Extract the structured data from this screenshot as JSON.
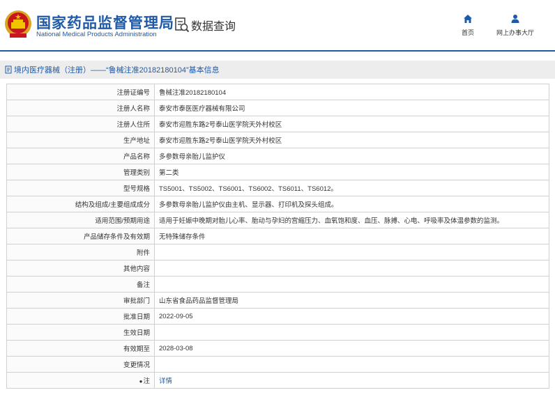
{
  "header": {
    "site_title": "国家药品监督管理局",
    "site_subtitle": "National Medical Products Administration",
    "query_title": "数据查询",
    "nav": [
      {
        "label": "首页",
        "icon": "home-icon"
      },
      {
        "label": "网上办事大厅",
        "icon": "user-icon"
      }
    ]
  },
  "section": {
    "title": "境内医疗器械（注册）——“鲁械注准20182180104”基本信息",
    "icon": "document-icon"
  },
  "rows": [
    {
      "label": "注册证编号",
      "value": "鲁械注准20182180104"
    },
    {
      "label": "注册人名称",
      "value": "泰安市泰医医疗器械有限公司"
    },
    {
      "label": "注册人住所",
      "value": "泰安市迎胜东路2号泰山医学院天外村校区"
    },
    {
      "label": "生产地址",
      "value": "泰安市迎胜东路2号泰山医学院天外村校区"
    },
    {
      "label": "产品名称",
      "value": "多参数母亲胎儿监护仪"
    },
    {
      "label": "管理类别",
      "value": "第二类"
    },
    {
      "label": "型号规格",
      "value": "TS5001、TS5002、TS6001、TS6002、TS6011、TS6012。"
    },
    {
      "label": "结构及组成/主要组成成分",
      "value": "多参数母亲胎儿监护仪由主机、显示器、打印机及探头组成。"
    },
    {
      "label": "适用范围/预期用途",
      "value": "适用于妊娠中晚期对胎儿心率、胎动与孕妇的宫缩压力、血氧饱和度、血压、脉搏、心电、呼吸率及体温参数的监测。"
    },
    {
      "label": "产品储存条件及有效期",
      "value": "无特殊储存条件"
    },
    {
      "label": "附件",
      "value": ""
    },
    {
      "label": "其他内容",
      "value": ""
    },
    {
      "label": "备注",
      "value": ""
    },
    {
      "label": "审批部门",
      "value": "山东省食品药品监督管理局"
    },
    {
      "label": "批准日期",
      "value": "2022-09-05"
    },
    {
      "label": "生效日期",
      "value": ""
    },
    {
      "label": "有效期至",
      "value": "2028-03-08"
    },
    {
      "label": "变更情况",
      "value": ""
    }
  ],
  "note_row": {
    "label": "注",
    "value": "详情",
    "icon": "note-icon"
  },
  "colors": {
    "brand": "#1f5aa8",
    "section_bg": "#ededed",
    "border": "#d0d0d0"
  }
}
